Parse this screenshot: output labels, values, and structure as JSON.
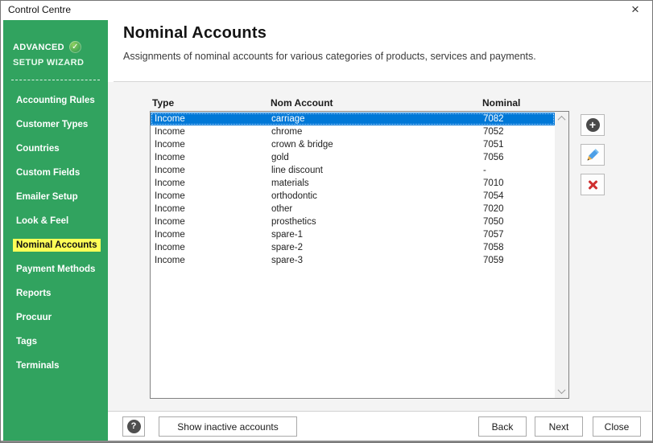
{
  "window": {
    "title": "Control Centre",
    "close_icon": "×"
  },
  "sidebar": {
    "badge_label": "ADVANCED",
    "badge_check": "✓",
    "subtitle": "SETUP WIZARD",
    "items": [
      {
        "label": "Accounting Rules",
        "active": false
      },
      {
        "label": "Customer Types",
        "active": false
      },
      {
        "label": "Countries",
        "active": false
      },
      {
        "label": "Custom Fields",
        "active": false
      },
      {
        "label": "Emailer Setup",
        "active": false
      },
      {
        "label": "Look & Feel",
        "active": false
      },
      {
        "label": "Nominal Accounts",
        "active": true
      },
      {
        "label": "Payment Methods",
        "active": false
      },
      {
        "label": "Reports",
        "active": false
      },
      {
        "label": "Procuur",
        "active": false
      },
      {
        "label": "Tags",
        "active": false
      },
      {
        "label": "Terminals",
        "active": false
      }
    ]
  },
  "header": {
    "title": "Nominal Accounts",
    "subtitle": "Assignments of nominal accounts for various categories of products, services and payments."
  },
  "table": {
    "columns": [
      "Type",
      "Nom Account",
      "Nominal"
    ],
    "selected_index": 0,
    "rows": [
      {
        "type": "Income",
        "account": "carriage",
        "nominal": "7082"
      },
      {
        "type": "Income",
        "account": "chrome",
        "nominal": "7052"
      },
      {
        "type": "Income",
        "account": "crown & bridge",
        "nominal": "7051"
      },
      {
        "type": "Income",
        "account": "gold",
        "nominal": "7056"
      },
      {
        "type": "Income",
        "account": "line discount",
        "nominal": "-"
      },
      {
        "type": "Income",
        "account": "materials",
        "nominal": "7010"
      },
      {
        "type": "Income",
        "account": "orthodontic",
        "nominal": "7054"
      },
      {
        "type": "Income",
        "account": "other",
        "nominal": "7020"
      },
      {
        "type": "Income",
        "account": "prosthetics",
        "nominal": "7050"
      },
      {
        "type": "Income",
        "account": "spare-1",
        "nominal": "7057"
      },
      {
        "type": "Income",
        "account": "spare-2",
        "nominal": "7058"
      },
      {
        "type": "Income",
        "account": "spare-3",
        "nominal": "7059"
      }
    ]
  },
  "actions": {
    "add_icon": "+",
    "edit_icon": "pencil",
    "delete_icon": "x"
  },
  "footer": {
    "help_icon": "?",
    "show_inactive_label": "Show inactive accounts",
    "back_label": "Back",
    "next_label": "Next",
    "close_label": "Close"
  },
  "colors": {
    "sidebar_green": "#31a35f",
    "active_item_yellow": "#ffff57",
    "selection_blue": "#0078d7",
    "edit_pencil_blue": "#4d9fe6",
    "delete_red": "#cf2f2f"
  }
}
